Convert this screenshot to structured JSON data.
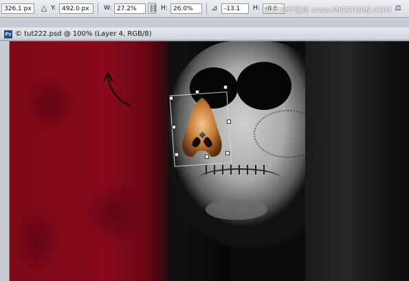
{
  "options_bar": {
    "x_value": "326.1 px",
    "y_label": "Y:",
    "y_value": "492.0 px",
    "w_label": "W:",
    "w_value": "27.2%",
    "h_label": "H:",
    "h_value": "26.0%",
    "angle_value": "-13.1",
    "hskew_label": "H:",
    "hskew_value": "-8.0",
    "watermark": "思缘设计论坛 www.MISSYUAN.COM"
  },
  "document": {
    "tab_badge": "Ps",
    "tab_title": "© tut222.psd @ 100% (Layer 4, RGB/8)"
  },
  "icons": [
    "reference-point-icon",
    "link-icon",
    "angle-icon",
    "warp-icon"
  ]
}
